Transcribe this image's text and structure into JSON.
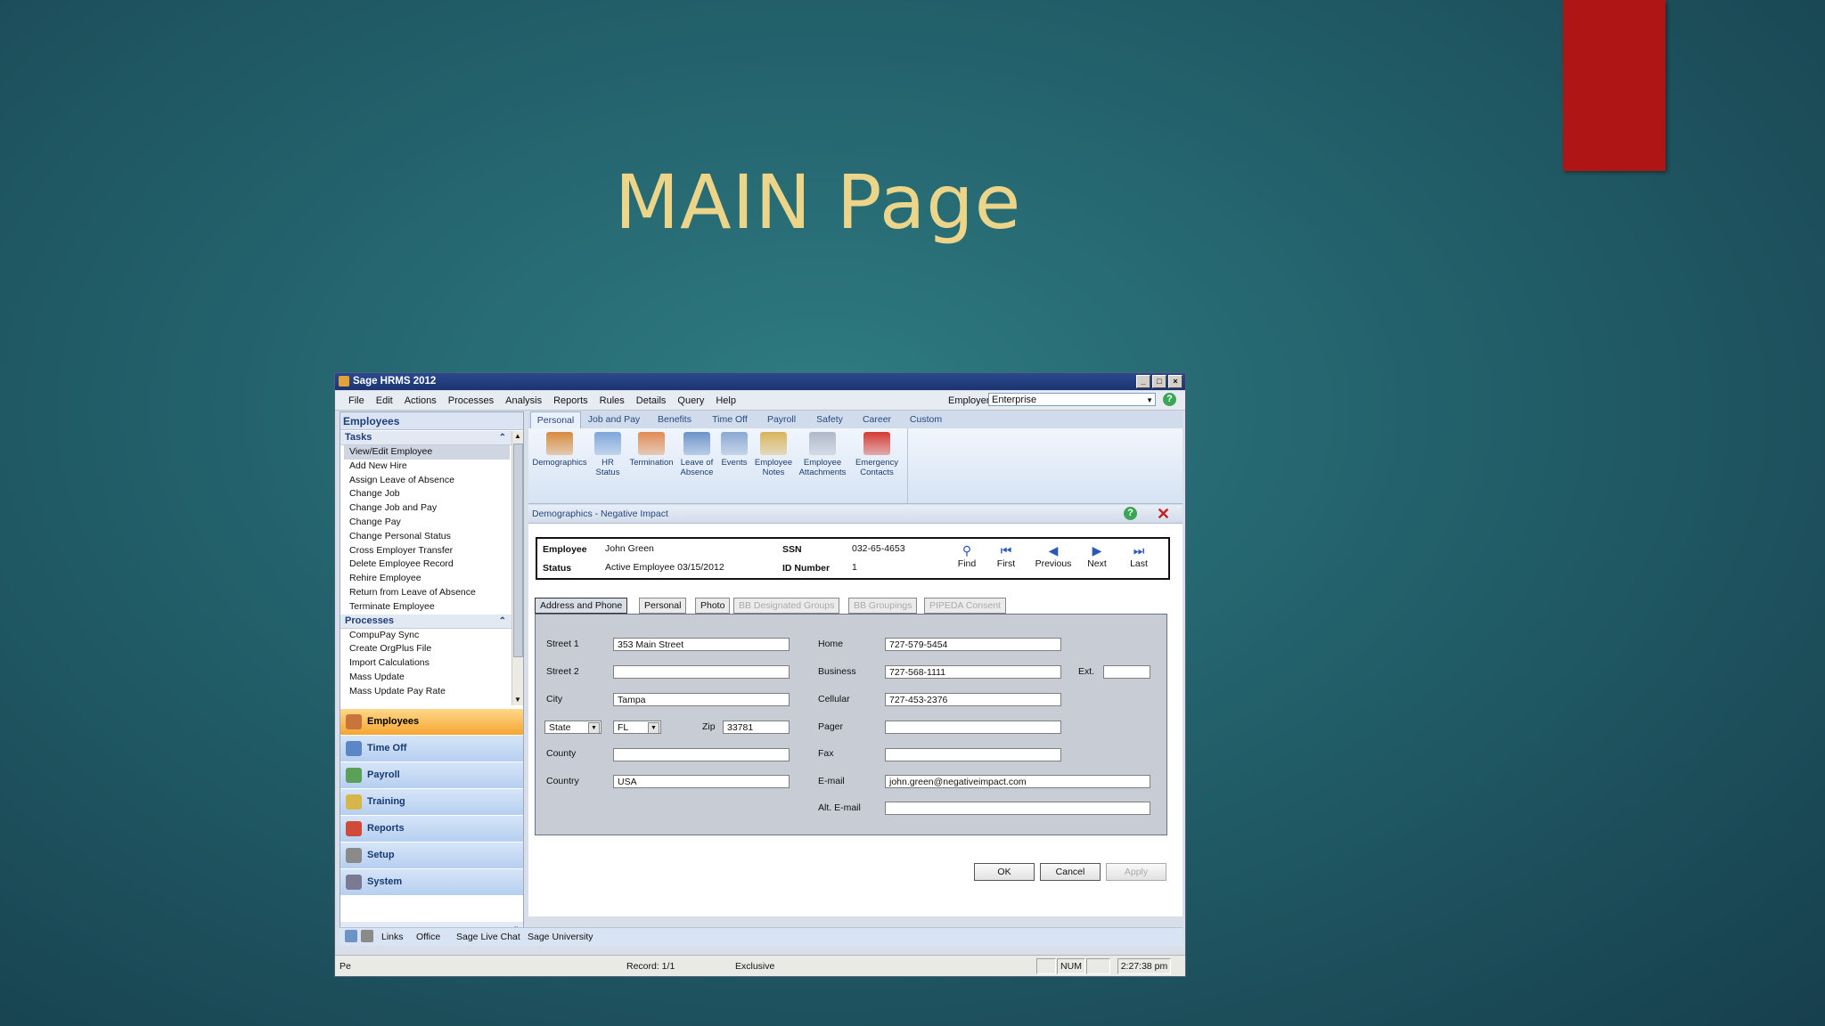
{
  "slide": {
    "title": "MAIN Page"
  },
  "window": {
    "title": "Sage HRMS 2012"
  },
  "menu": [
    "File",
    "Edit",
    "Actions",
    "Processes",
    "Analysis",
    "Reports",
    "Rules",
    "Details",
    "Query",
    "Help"
  ],
  "employer": {
    "label": "Employer",
    "value": "Enterprise"
  },
  "sidebar": {
    "title": "Employees",
    "tasks_header": "Tasks",
    "tasks": [
      "View/Edit Employee",
      "Add New Hire",
      "Assign Leave of Absence",
      "Change Job",
      "Change Job and Pay",
      "Change Pay",
      "Change Personal Status",
      "Cross Employer Transfer",
      "Delete Employee Record",
      "Rehire Employee",
      "Return from Leave of Absence",
      "Terminate Employee"
    ],
    "processes_header": "Processes",
    "processes": [
      "CompuPay Sync",
      "Create OrgPlus File",
      "Import Calculations",
      "Mass Update",
      "Mass Update Pay Rate"
    ],
    "nav": [
      {
        "label": "Employees",
        "color": "#c8743a"
      },
      {
        "label": "Time Off",
        "color": "#5b86c8"
      },
      {
        "label": "Payroll",
        "color": "#5aa058"
      },
      {
        "label": "Training",
        "color": "#d6b64a"
      },
      {
        "label": "Reports",
        "color": "#d04a3a"
      },
      {
        "label": "Setup",
        "color": "#8a8a8a"
      },
      {
        "label": "System",
        "color": "#7a7a92"
      }
    ]
  },
  "tabs": [
    "Personal",
    "Job and Pay",
    "Benefits",
    "Time Off",
    "Payroll",
    "Safety",
    "Career",
    "Custom"
  ],
  "ribbon": [
    {
      "l1": "Demographics",
      "l2": "",
      "l3": "",
      "icon": "house-icon",
      "color": "#d78a3c"
    },
    {
      "l1": "HR",
      "l2": "Status",
      "l3": "",
      "icon": "folder-icon",
      "color": "#7ea6d8"
    },
    {
      "l1": "Termination",
      "l2": "",
      "l3": "",
      "icon": "person-icon",
      "color": "#e08a52"
    },
    {
      "l1": "Leave of",
      "l2": "Absence",
      "l3": "",
      "icon": "calendar-icon",
      "color": "#6c93c8"
    },
    {
      "l1": "Events",
      "l2": "",
      "l3": "",
      "icon": "events-icon",
      "color": "#8aa8d0"
    },
    {
      "l1": "Employee",
      "l2": "Notes",
      "l3": "",
      "icon": "notes-icon",
      "color": "#d8b45a"
    },
    {
      "l1": "Employee",
      "l2": "Attachments",
      "l3": "",
      "icon": "attachment-icon",
      "color": "#b0b8c8"
    },
    {
      "l1": "Emergency",
      "l2": "Contacts",
      "l3": "",
      "icon": "phone-icon",
      "color": "#d43a32"
    }
  ],
  "content": {
    "title": "Demographics - Negative Impact",
    "employee_label": "Employee",
    "employee": "John Green",
    "ssn_label": "SSN",
    "ssn": "032-65-4653",
    "status_label": "Status",
    "status": "Active Employee 03/15/2012",
    "id_label": "ID Number",
    "id": "1",
    "nav": [
      "Find",
      "First",
      "Previous",
      "Next",
      "Last"
    ]
  },
  "subtabs": [
    "Address and Phone",
    "Personal",
    "Photo",
    "BB Designated Groups",
    "BB Groupings",
    "PIPEDA Consent"
  ],
  "form": {
    "street1_label": "Street 1",
    "street1": "353 Main Street",
    "street2_label": "Street 2",
    "street2": "",
    "city_label": "City",
    "city": "Tampa",
    "state_label": "State",
    "state": "FL",
    "zip_label": "Zip",
    "zip": "33781",
    "county_label": "County",
    "county": "",
    "country_label": "Country",
    "country": "USA",
    "home_label": "Home",
    "home": "727-579-5454",
    "business_label": "Business",
    "business": "727-568-1111",
    "ext_label": "Ext.",
    "ext": "",
    "cellular_label": "Cellular",
    "cellular": "727-453-2376",
    "pager_label": "Pager",
    "pager": "",
    "fax_label": "Fax",
    "fax": "",
    "email_label": "E-mail",
    "email": "john.green@negativeimpact.com",
    "altemail_label": "Alt. E-mail",
    "altemail": ""
  },
  "buttons": {
    "ok": "OK",
    "cancel": "Cancel",
    "apply": "Apply"
  },
  "links": [
    "Links",
    "Office",
    "Sage Live Chat",
    "Sage University"
  ],
  "status": {
    "left": "Pe",
    "record": "Record: 1/1",
    "mode": "Exclusive",
    "num": "NUM",
    "time": "2:27:38 pm"
  }
}
